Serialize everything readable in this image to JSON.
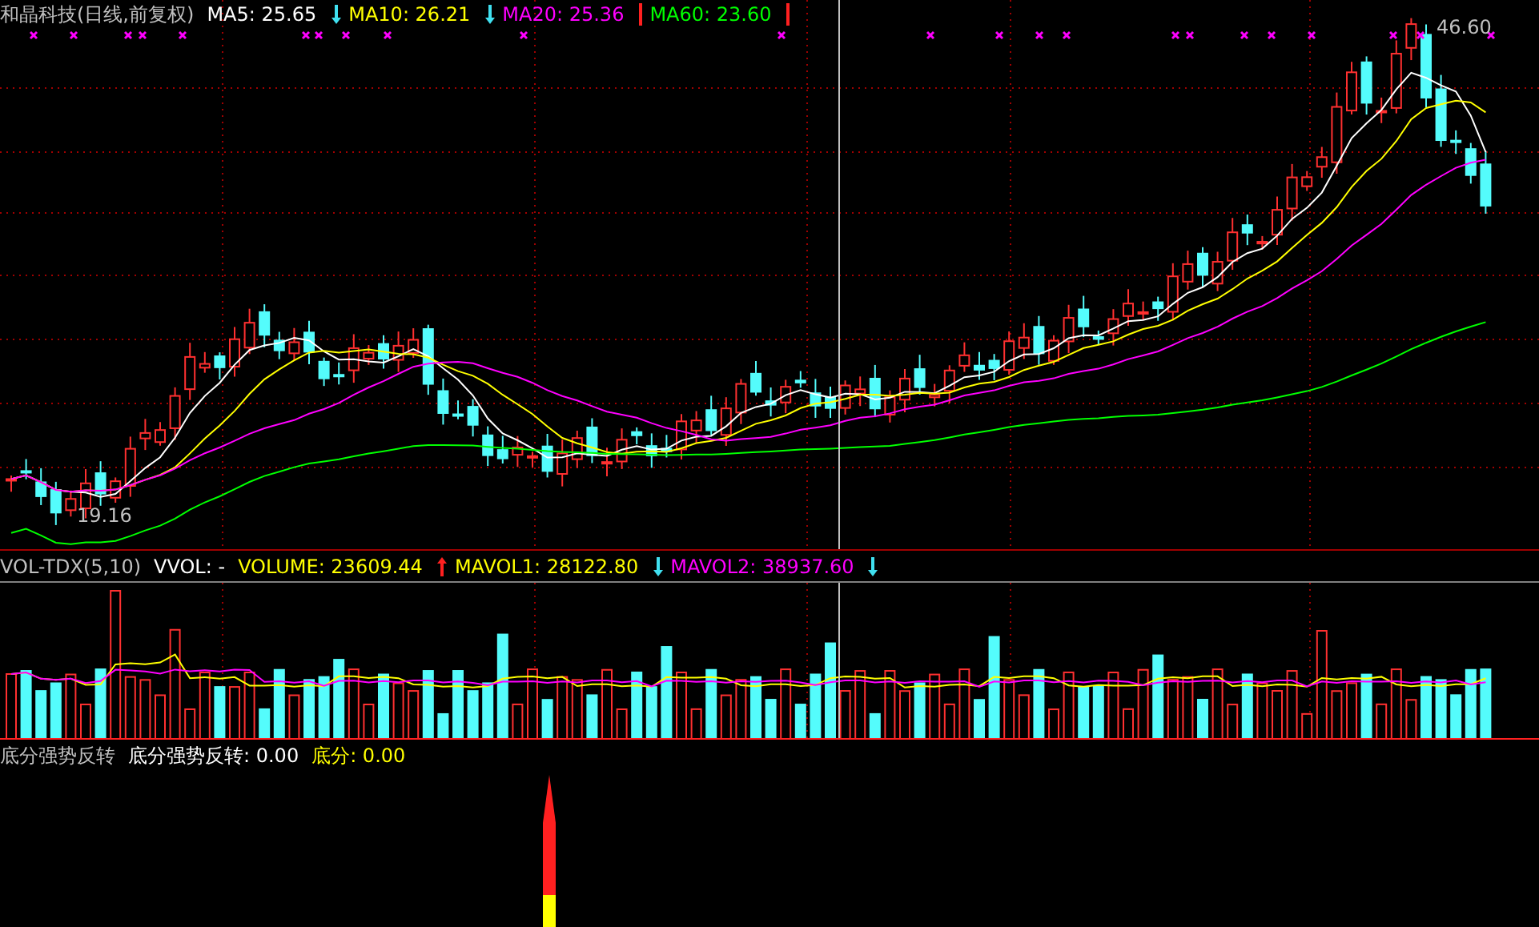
{
  "main_panel": {
    "title": "和晶科技(日线,前复权)",
    "legend": [
      {
        "label": "MA5: 25.65",
        "color": "#ffffff",
        "kind": "down"
      },
      {
        "label": "MA10: 26.21",
        "color": "#ffff00",
        "kind": "down"
      },
      {
        "label": "MA20: 25.36",
        "color": "#ff00ff",
        "kind": "bar"
      },
      {
        "label": "MA60: 23.60",
        "color": "#00ff00",
        "kind": "bar"
      }
    ],
    "high_label": "46.60",
    "low_label": "19.16"
  },
  "volume_panel": {
    "title": "VOL-TDX(5,10)",
    "legend": [
      {
        "label": "VVOL: -",
        "color": "#ffffff"
      },
      {
        "label": "VOLUME: 23609.44",
        "color": "#ffff00",
        "kind": "up"
      },
      {
        "label": "MAVOL1: 28122.80",
        "color": "#ffff00",
        "kind": "down"
      },
      {
        "label": "MAVOL2: 38937.60",
        "color": "#ff00ff",
        "kind": "down"
      }
    ]
  },
  "indicator_panel": {
    "title": "底分强势反转",
    "legend": [
      {
        "label": "底分强势反转: 0.00",
        "color": "#ffffff"
      },
      {
        "label": "底分: 0.00",
        "color": "#ffff00"
      }
    ]
  }
}
